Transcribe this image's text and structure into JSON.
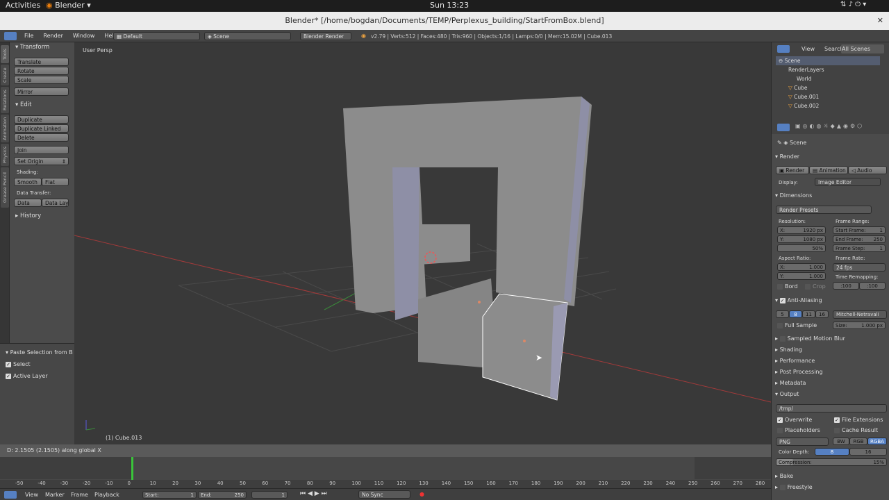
{
  "system": {
    "activities": "Activities",
    "app": "Blender",
    "clock": "Sun 13:23"
  },
  "window": {
    "title": "Blender* [/home/bogdan/Documents/TEMP/Perplexus_building/StartFromBox.blend]"
  },
  "infobar": {
    "menus": [
      "File",
      "Render",
      "Window",
      "Help"
    ],
    "layout": "Default",
    "scene": "Scene",
    "engine": "Blender Render",
    "stats": "v2.79 | Verts:512 | Faces:480 | Tris:960 | Objects:1/16 | Lamps:0/0 | Mem:15.02M | Cube.013"
  },
  "tool_tabs": [
    "Tools",
    "Create",
    "Relations",
    "Animation",
    "Physics",
    "Grease Pencil"
  ],
  "toolshelf": {
    "transform_header": "Transform",
    "transform": [
      "Translate",
      "Rotate",
      "Scale",
      "Mirror"
    ],
    "edit_header": "Edit",
    "edit": [
      "Duplicate",
      "Duplicate Linked",
      "Delete",
      "Join",
      "Set Origin"
    ],
    "shading_label": "Shading:",
    "smooth": "Smooth",
    "flat": "Flat",
    "data_transfer_label": "Data Transfer:",
    "data": "Data",
    "data_layo": "Data Layo",
    "history": "History"
  },
  "redo": {
    "title": "Paste Selection from Bu",
    "select": "Select",
    "active_layer": "Active Layer"
  },
  "viewport": {
    "view_name": "User Persp",
    "object_label": "(1) Cube.013"
  },
  "status": {
    "text": "D: 2.1505 (2.1505) along global X"
  },
  "timeline": {
    "ticks": [
      "-50",
      "-40",
      "-30",
      "-20",
      "-10",
      "0",
      "10",
      "20",
      "30",
      "40",
      "50",
      "60",
      "70",
      "80",
      "90",
      "100",
      "110",
      "120",
      "130",
      "140",
      "150",
      "160",
      "170",
      "180",
      "190",
      "200",
      "210",
      "220",
      "230",
      "240",
      "250",
      "260",
      "270",
      "280"
    ],
    "menus": [
      "View",
      "Marker",
      "Frame",
      "Playback"
    ],
    "start_label": "Start:",
    "start": "1",
    "end_label": "End:",
    "end": "250",
    "current": "1",
    "sync": "No Sync"
  },
  "outliner": {
    "menus": [
      "View",
      "Search"
    ],
    "filter": "All Scenes",
    "items": [
      "Scene",
      "RenderLayers",
      "World",
      "Cube",
      "Cube.001",
      "Cube.002"
    ]
  },
  "props": {
    "scene": "Scene",
    "render_header": "Render",
    "render_btn": "Render",
    "animation_btn": "Animation",
    "audio_btn": "Audio",
    "display_label": "Display:",
    "display": "Image Editor",
    "dimensions": "Dimensions",
    "presets": "Render Presets",
    "resolution_label": "Resolution:",
    "res_x": "X:",
    "res_x_val": "1920 px",
    "res_y": "Y:",
    "res_y_val": "1080 px",
    "res_pct": "50%",
    "frame_range_label": "Frame Range:",
    "start_frame": "Start Frame:",
    "start_frame_val": "1",
    "end_frame": "End Frame:",
    "end_frame_val": "250",
    "frame_step": "Frame Step:",
    "frame_step_val": "1",
    "aspect_label": "Aspect Ratio:",
    "asp_x": "X:",
    "asp_x_val": "1.000",
    "asp_y": "Y:",
    "asp_y_val": "1.000",
    "frame_rate_label": "Frame Rate:",
    "frame_rate": "24 fps",
    "time_remap_label": "Time Remapping:",
    "remap_old": ":100",
    "remap_new": ":100",
    "bord": "Bord",
    "crop": "Crop",
    "aa": "Anti-Aliasing",
    "aa_samples": [
      "5",
      "8",
      "11",
      "16"
    ],
    "aa_filter": "Mitchell-Netravali",
    "full_sample": "Full Sample",
    "size_label": "Size:",
    "size_val": "1.000 px",
    "sampled_motion_blur": "Sampled Motion Blur",
    "shading": "Shading",
    "performance": "Performance",
    "post_processing": "Post Processing",
    "metadata": "Metadata",
    "output": "Output",
    "output_path": "/tmp/",
    "overwrite": "Overwrite",
    "file_extensions": "File Extensions",
    "placeholders": "Placeholders",
    "cache_result": "Cache Result",
    "format": "PNG",
    "bw": "BW",
    "rgb": "RGB",
    "rgba": "RGBA",
    "color_depth_label": "Color Depth:",
    "depth_8": "8",
    "depth_16": "16",
    "compression_label": "Compression:",
    "compression_val": "15%",
    "bake": "Bake",
    "freestyle": "Freestyle"
  },
  "colors": {
    "accent": "#5680c2",
    "frame_cursor": "#3ac43a",
    "selected_outline": "#ffffff",
    "object_grey": "#8c8c8c"
  }
}
